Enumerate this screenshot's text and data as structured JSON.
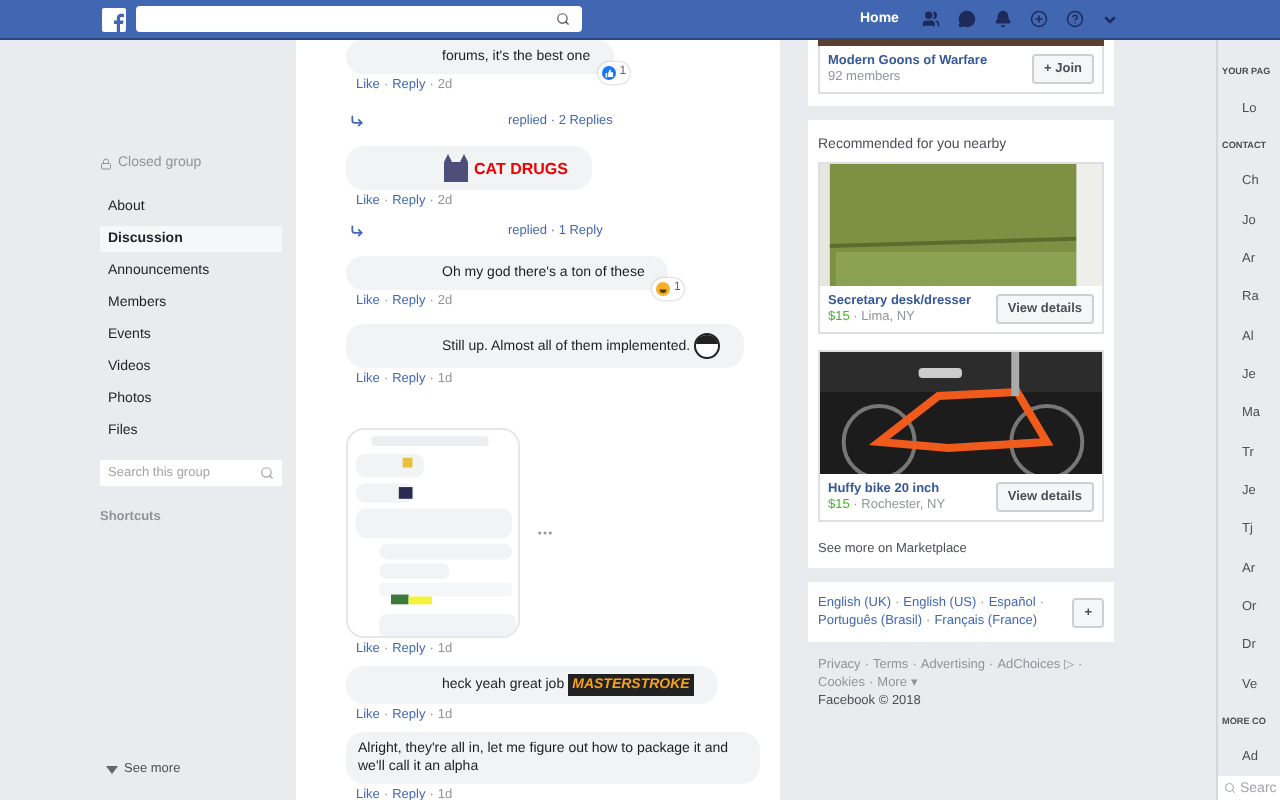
{
  "separator": "·",
  "header": {
    "nav": [
      {
        "label": "Home",
        "selected": true
      }
    ]
  },
  "group_sidebar": {
    "privacy": "Closed group",
    "items": [
      {
        "label": "About",
        "selected": false
      },
      {
        "label": "Discussion",
        "selected": true
      },
      {
        "label": "Announcements",
        "selected": false
      },
      {
        "label": "Members",
        "selected": false
      },
      {
        "label": "Events",
        "selected": false
      },
      {
        "label": "Videos",
        "selected": false
      },
      {
        "label": "Photos",
        "selected": false
      },
      {
        "label": "Files",
        "selected": false
      }
    ],
    "search": {
      "placeholder": "Search this group"
    },
    "shortcuts": "Shortcuts",
    "see_more": "See more"
  },
  "comments": [
    {
      "kind": "comment",
      "text": "forums, it's the best one",
      "reaction": {
        "kind": "like",
        "count": "1"
      },
      "like": "Like",
      "reply": "Reply",
      "time": "2d"
    },
    {
      "kind": "replies",
      "text": "replied",
      "count": "2 Replies"
    },
    {
      "kind": "comment",
      "sticker": {
        "kind": "cat",
        "text": "CAT DRUGS"
      },
      "like": "Like",
      "reply": "Reply",
      "time": "2d"
    },
    {
      "kind": "replies",
      "text": "replied",
      "count": "1 Reply"
    },
    {
      "kind": "comment",
      "text": "Oh my god there's a ton of these",
      "reaction": {
        "kind": "laugh",
        "count": "1"
      },
      "like": "Like",
      "reply": "Reply",
      "time": "2d"
    },
    {
      "kind": "comment",
      "text": "Still up. Almost all of them implemented.",
      "face_avatar": true,
      "like": "Like",
      "reply": "Reply",
      "time": "1d"
    },
    {
      "like": "Like",
      "reply": "Reply",
      "time": "1d"
    },
    {
      "kind": "comment",
      "text": "heck yeah great job",
      "sticker": {
        "kind": "banner",
        "text": "MASTERSTROKE"
      },
      "like": "Like",
      "reply": "Reply",
      "time": "1d"
    },
    {
      "kind": "comment",
      "text": "Alright, they're all in, let me figure out how to package it and we'll call it an alpha",
      "like": "Like",
      "reply": "Reply",
      "time": "1d"
    }
  ],
  "group_card": {
    "name": "Modern Goons of Warfare",
    "members": "92 members",
    "button": "+ Join"
  },
  "marketplace": {
    "title": "Recommended for you nearby",
    "items": [
      {
        "kind": "desk",
        "name": "Secretary desk/dresser",
        "price": "$15",
        "location": "Lima, NY",
        "button": "View details"
      },
      {
        "kind": "bike",
        "name": "Huffy bike 20 inch",
        "price": "$15",
        "location": "Rochester, NY",
        "button": "View details"
      }
    ],
    "see_more": "See more on Marketplace"
  },
  "languages": {
    "links": [
      "English (UK)",
      "English (US)",
      "Español",
      "Português (Brasil)",
      "Français (France)"
    ],
    "button": "+"
  },
  "footer": {
    "links": [
      "Privacy",
      "Terms",
      "Advertising",
      "AdChoices ▷",
      "Cookies",
      "More ▾"
    ],
    "copyright": "Facebook © 2018"
  },
  "chat": {
    "sections": [
      {
        "heading": "YOUR PAG",
        "contacts": [
          "Lo"
        ]
      },
      {
        "heading": "CONTACT",
        "contacts": [
          "Ch",
          "Jo",
          "Ar",
          "Ra",
          "Al",
          "Je",
          "Ma",
          "Tr",
          "Je",
          "Tj",
          "Ar",
          "Or",
          "Dr",
          "Ve"
        ]
      },
      {
        "heading": "MORE CO",
        "contacts": [
          "Ad"
        ]
      }
    ],
    "search": {
      "placeholder": "Searc"
    }
  }
}
